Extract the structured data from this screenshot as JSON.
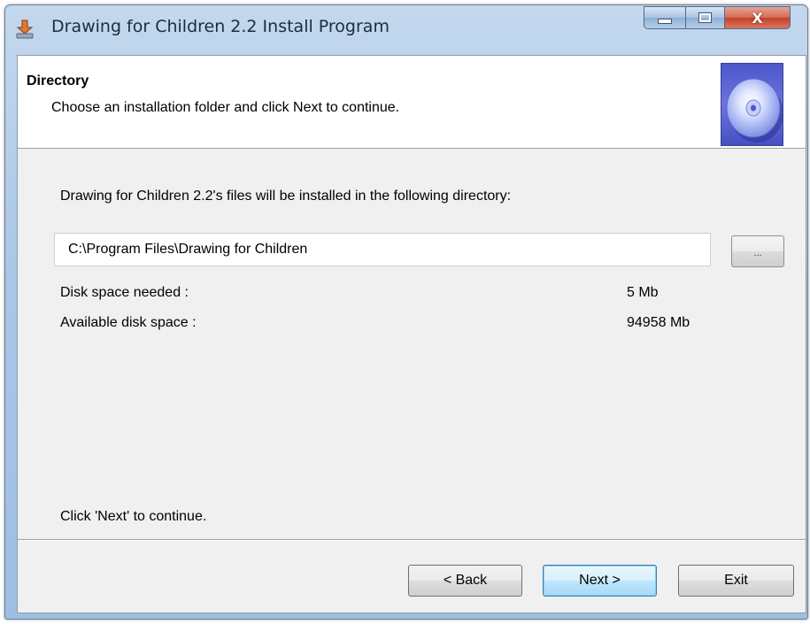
{
  "window": {
    "title": "Drawing for Children 2.2 Install Program"
  },
  "header": {
    "title": "Directory",
    "subtitle": "Choose an installation folder and click Next to continue."
  },
  "main": {
    "intro": "Drawing for Children 2.2's files will be installed in the following directory:",
    "path_value": "C:\\Program Files\\Drawing for Children",
    "browse_label": "...",
    "disk_needed_label": "Disk space needed :",
    "disk_needed_value": "5 Mb",
    "disk_available_label": "Available disk space :",
    "disk_available_value": "94958 Mb",
    "footer_note": "Click 'Next' to continue."
  },
  "buttons": {
    "back": "< Back",
    "next": "Next >",
    "exit": "Exit"
  },
  "icons": {
    "app": "installer-icon",
    "header": "cd-disc-icon"
  }
}
